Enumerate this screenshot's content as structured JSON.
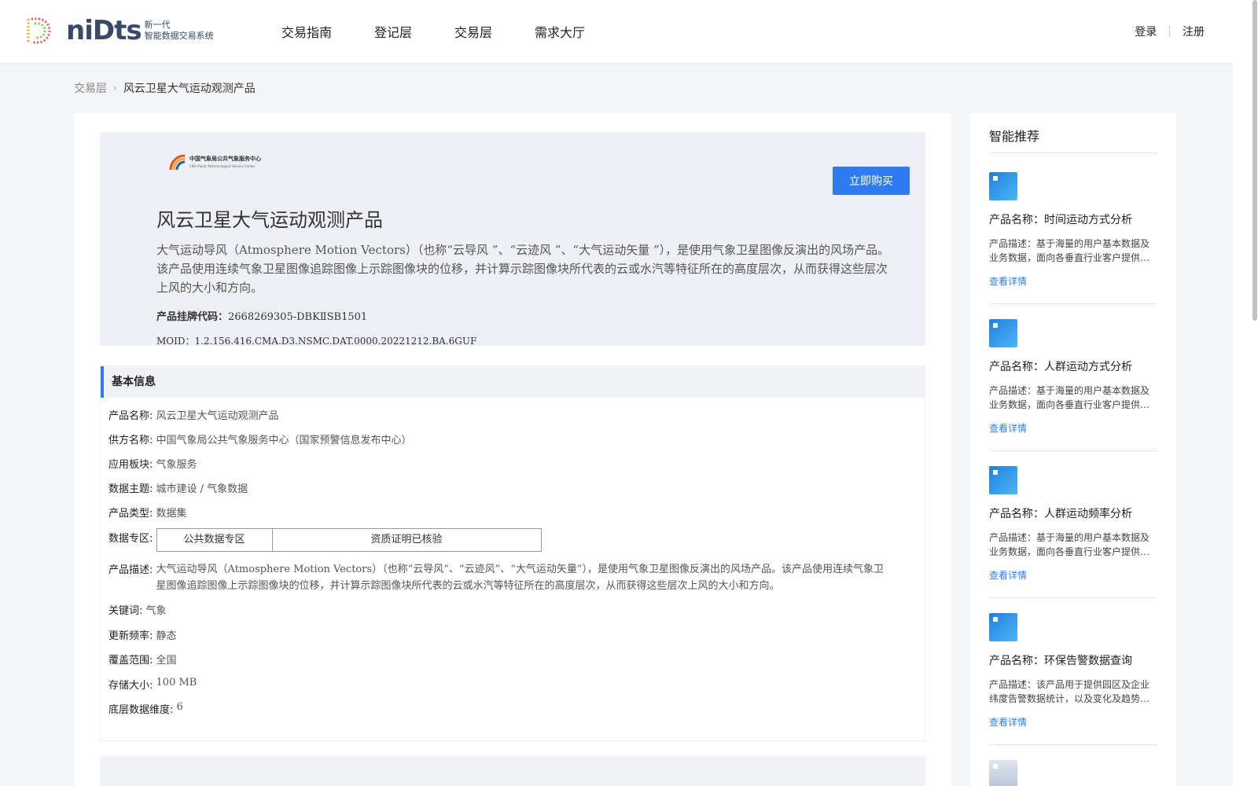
{
  "header": {
    "logo_word": "niDts",
    "logo_sub_line1": "新一代",
    "logo_sub_line2": "智能数据交易系统",
    "nav": [
      "交易指南",
      "登记层",
      "交易层",
      "需求大厅"
    ],
    "login": "登录",
    "register": "注册"
  },
  "breadcrumb": {
    "parent": "交易层",
    "current": "风云卫星大气运动观测产品"
  },
  "hero": {
    "org_name": "中国气象局公共气象服务中心",
    "org_name_en": "CMA Public Meteorological Service Center",
    "buy_button": "立即购买",
    "title": "风云卫星大气运动观测产品",
    "description": "大气运动导风（Atmosphere Motion Vectors）（也称“云导风 ”、“云迹风 ”、“大气运动矢量 ”），是使用气象卫星图像反演出的风场产品。该产品使用连续气象卫星图像追踪图像上示踪图像块的位移，并计算示踪图像块所代表的云或水汽等特征所在的高度层次，从而获得这些层次上风的大小和方向。",
    "code_label": "产品挂牌代码：",
    "code_value": "2668269305-DBKⅡSB1501",
    "moid_label": "MOID：",
    "moid_value": "1.2.156.416.CMA.D3.NSMC.DAT.0000.20221212.BA.6GUF"
  },
  "basic_info": {
    "heading": "基本信息",
    "product_name_label": "产品名称:",
    "product_name": "风云卫星大气运动观测产品",
    "supplier_label": "供方名称:",
    "supplier": "中国气象局公共气象服务中心（国家预警信息发布中心）",
    "sector_label": "应用板块:",
    "sector": "气象服务",
    "theme_label": "数据主题:",
    "theme": "城市建设 / 气象数据",
    "type_label": "产品类型:",
    "type": "数据集",
    "zone_label": "数据专区:",
    "zone_cells": [
      "公共数据专区",
      "资质证明已核验"
    ],
    "desc_label": "产品描述:",
    "desc": "大气运动导风（Atmosphere Motion Vectors）（也称“云导风”、“云迹风”、“大气运动矢量”），是使用气象卫星图像反演出的风场产品。该产品使用连续气象卫星图像追踪图像上示踪图像块的位移，并计算示踪图像块所代表的云或水汽等特征所在的高度层次，从而获得这些层次上风的大小和方向。",
    "keyword_label": "关键词:",
    "keyword": "气象",
    "freq_label": "更新频率:",
    "freq": "静态",
    "coverage_label": "覆盖范围:",
    "coverage": "全国",
    "size_label": "存储大小:",
    "size": "100 MB",
    "dims_label": "底层数据维度:",
    "dims": "6"
  },
  "sidebar": {
    "title": "智能推荐",
    "items": [
      {
        "name": "产品名称：时间运动方式分析",
        "desc": "产品描述：基于海量的用户基本数据及业务数据，面向各垂直行业客户提供…",
        "link": "查看详情"
      },
      {
        "name": "产品名称：人群运动方式分析",
        "desc": "产品描述：基于海量的用户基本数据及业务数据，面向各垂直行业客户提供…",
        "link": "查看详情"
      },
      {
        "name": "产品名称：人群运动频率分析",
        "desc": "产品描述：基于海量的用户基本数据及业务数据，面向各垂直行业客户提供…",
        "link": "查看详情"
      },
      {
        "name": "产品名称：环保告警数据查询",
        "desc": "产品描述：该产品用于提供园区及企业纬度告警数据统计，以及变化及趋势…",
        "link": "查看详情"
      }
    ]
  }
}
